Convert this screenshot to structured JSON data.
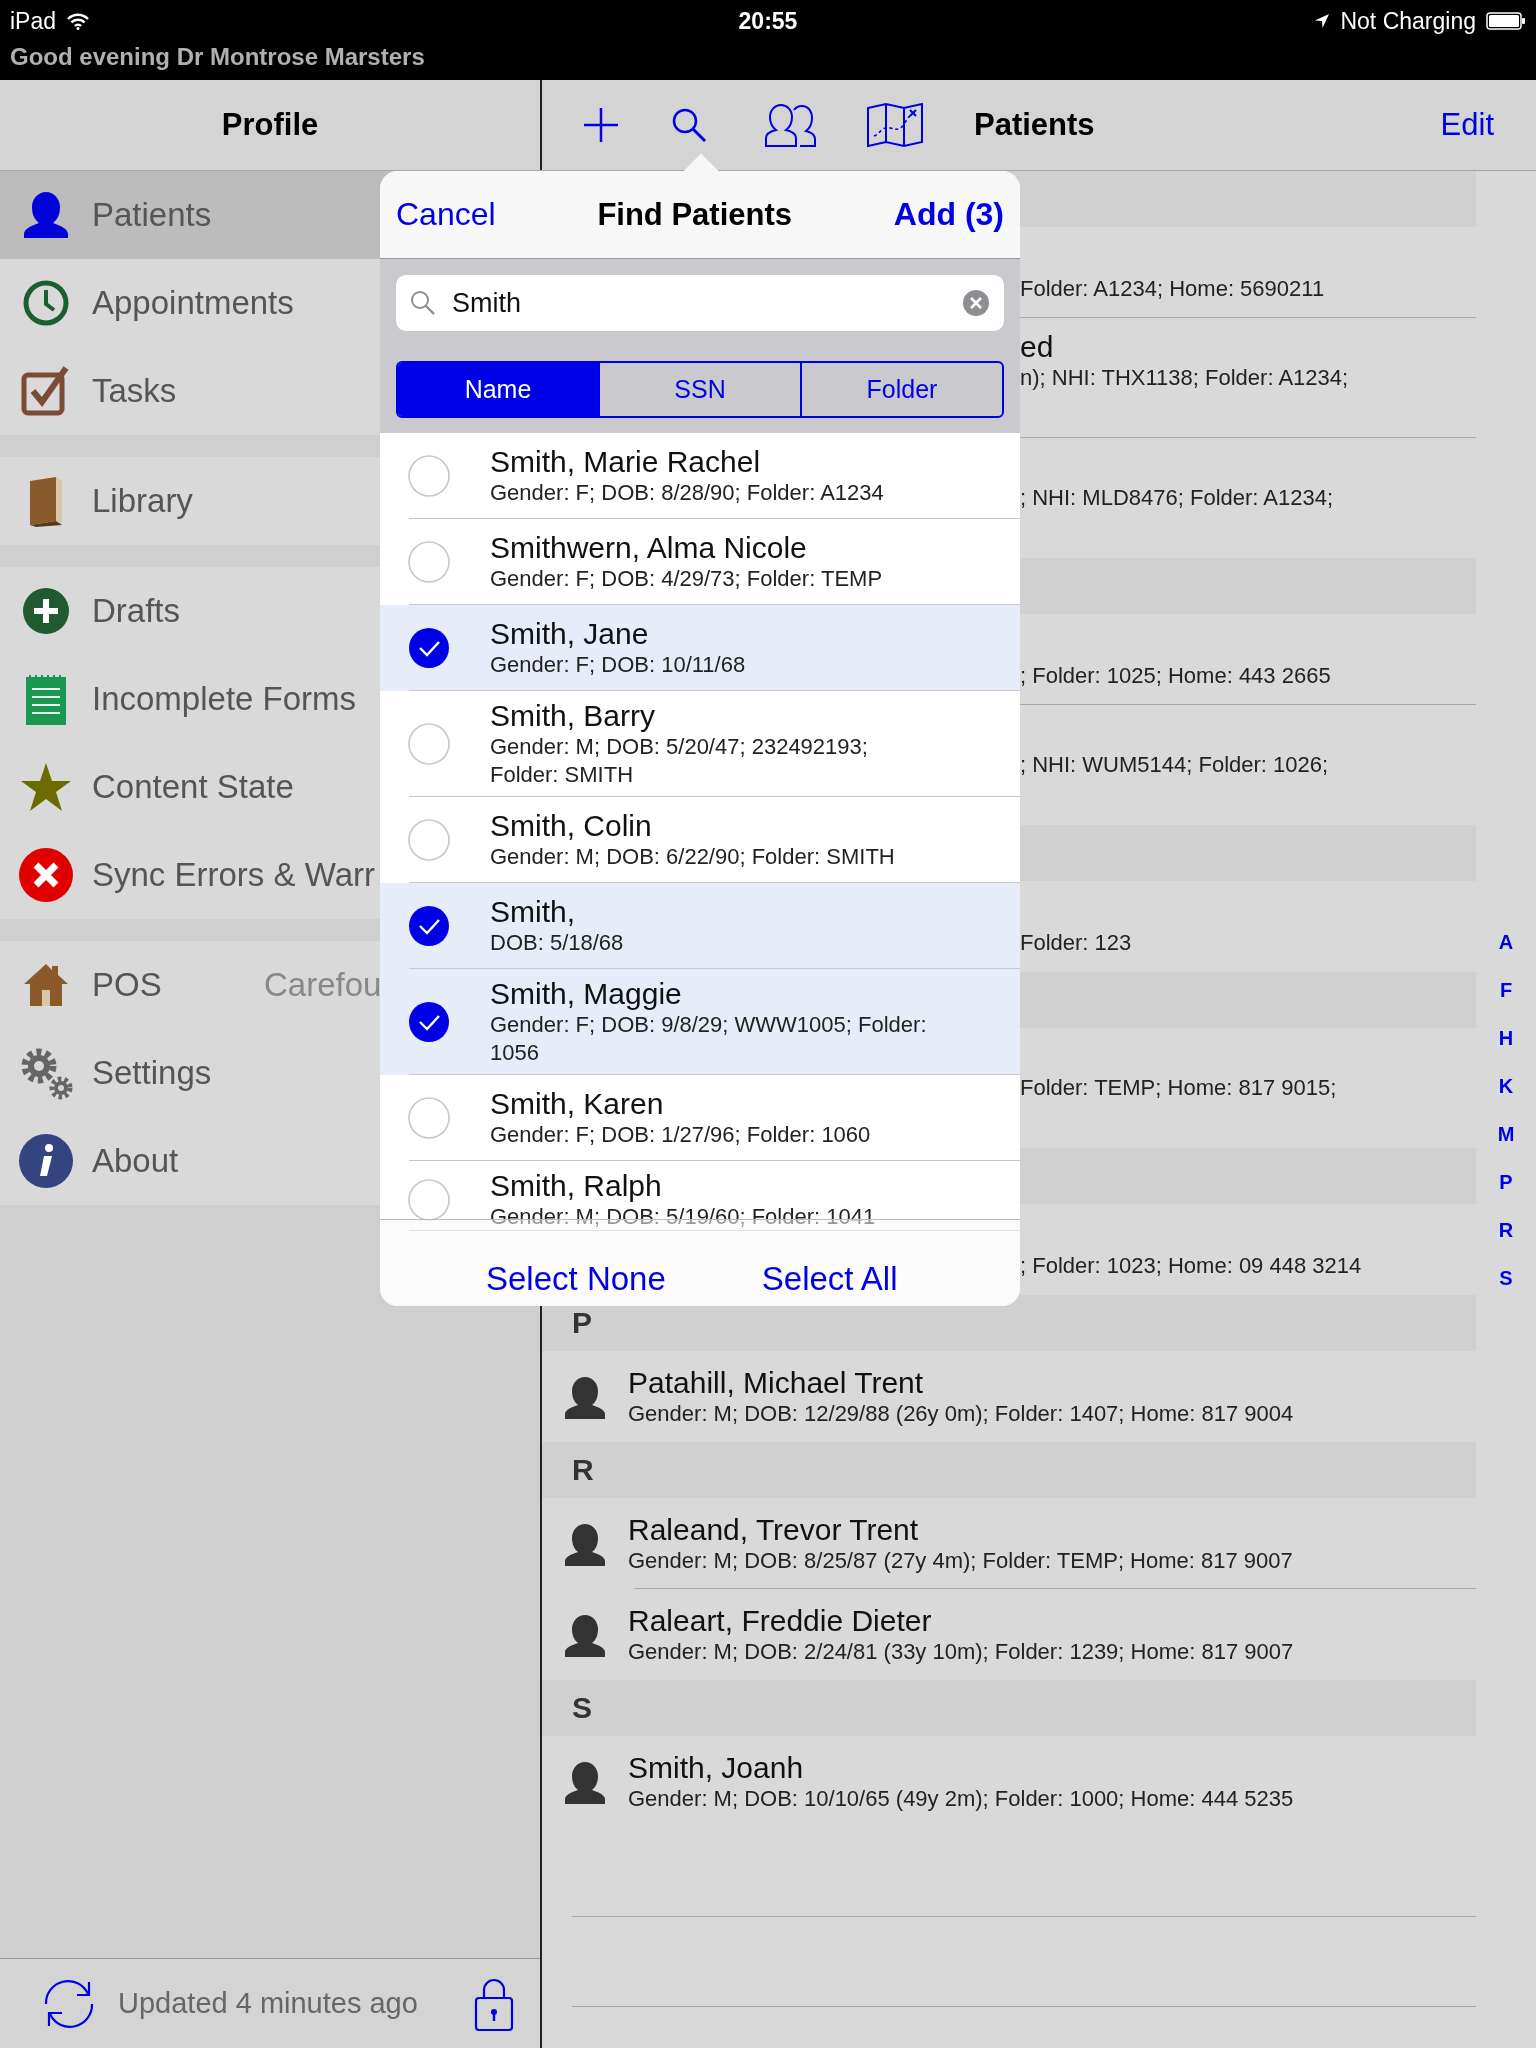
{
  "status_bar": {
    "device": "iPad",
    "time": "20:55",
    "battery_status": "Not Charging",
    "greeting": "Good evening Dr Montrose Marsters"
  },
  "sidebar": {
    "title": "Profile",
    "groups": [
      [
        {
          "label": "Patients",
          "selected": true
        },
        {
          "label": "Appointments",
          "selected": false
        },
        {
          "label": "Tasks",
          "selected": false
        }
      ],
      [
        {
          "label": "Library",
          "selected": false
        }
      ],
      [
        {
          "label": "Drafts",
          "selected": false
        },
        {
          "label": "Incomplete Forms",
          "selected": false
        },
        {
          "label": "Content State",
          "selected": false
        },
        {
          "label": "Sync Errors & Warr",
          "selected": false
        }
      ],
      [
        {
          "label": "POS",
          "detail": "Carefou",
          "selected": false
        },
        {
          "label": "Settings",
          "selected": false
        },
        {
          "label": "About",
          "selected": false
        }
      ]
    ],
    "footer": {
      "text": "Updated 4 minutes ago"
    }
  },
  "navbar": {
    "title": "Patients",
    "edit": "Edit"
  },
  "patients_list": {
    "sections": [
      {
        "rows": [
          {
            "kind": "partial",
            "details": "Folder: A1234; Home: 5690211",
            "wrapped": false
          },
          {
            "kind": "partial",
            "name": "ed",
            "details": "n); NHI: THX1138; Folder: A1234;",
            "wrapped": true
          },
          {
            "kind": "partial",
            "details": "; NHI: MLD8476; Folder: A1234;",
            "wrapped": true
          }
        ]
      },
      {
        "rows": [
          {
            "kind": "partial",
            "details": "; Folder: 1025; Home: 443 2665",
            "wrapped": false
          },
          {
            "kind": "partial",
            "details": "; NHI: WUM5144; Folder: 1026;",
            "wrapped": true
          }
        ]
      },
      {
        "rows": [
          {
            "kind": "partial",
            "details": "Folder: 123",
            "wrapped": false
          }
        ]
      },
      {
        "rows": [
          {
            "kind": "partial",
            "details": "Folder: TEMP; Home: 817 9015;",
            "wrapped": true
          }
        ]
      },
      {
        "rows": [
          {
            "kind": "partial",
            "details": "; Folder: 1023; Home: 09 448 3214",
            "wrapped": false
          }
        ]
      },
      {
        "letter": "P",
        "rows": [
          {
            "kind": "full",
            "name": "Patahill, Michael Trent",
            "details": "Gender: M; DOB: 12/29/88 (26y 0m); Folder: 1407; Home: 817 9004"
          }
        ]
      },
      {
        "letter": "R",
        "rows": [
          {
            "kind": "full",
            "name": "Raleand, Trevor Trent",
            "details": "Gender: M; DOB: 8/25/87 (27y 4m); Folder: TEMP; Home: 817 9007"
          },
          {
            "kind": "full",
            "name": "Raleart, Freddie Dieter",
            "details": "Gender: M; DOB: 2/24/81 (33y 10m); Folder: 1239; Home: 817 9007"
          }
        ]
      },
      {
        "letter": "S",
        "rows": [
          {
            "kind": "full",
            "name": "Smith, Joanh",
            "details": "Gender: M; DOB: 10/10/65 (49y 2m); Folder: 1000; Home: 444 5235"
          }
        ]
      }
    ],
    "index": [
      "A",
      "F",
      "H",
      "K",
      "M",
      "P",
      "R",
      "S"
    ]
  },
  "find_patients": {
    "cancel": "Cancel",
    "title": "Find Patients",
    "add": "Add (3)",
    "search": {
      "value": "Smith"
    },
    "segments": [
      {
        "label": "Name",
        "selected": true
      },
      {
        "label": "SSN",
        "selected": false
      },
      {
        "label": "Folder",
        "selected": false
      }
    ],
    "results": [
      {
        "name": "Smith, Marie Rachel",
        "details": "Gender: F; DOB: 8/28/90; Folder: A1234",
        "selected": false
      },
      {
        "name": "Smithwern, Alma Nicole",
        "details": "Gender: F; DOB: 4/29/73; Folder: TEMP",
        "selected": false
      },
      {
        "name": "Smith, Jane",
        "details": "Gender: F; DOB: 10/11/68",
        "selected": true
      },
      {
        "name": "Smith, Barry",
        "details": "Gender: M; DOB: 5/20/47; 232492193; Folder: SMITH",
        "selected": false
      },
      {
        "name": "Smith, Colin",
        "details": "Gender: M; DOB: 6/22/90; Folder: SMITH",
        "selected": false
      },
      {
        "name": "Smith,",
        "details": "DOB: 5/18/68",
        "selected": true
      },
      {
        "name": "Smith, Maggie",
        "details": "Gender: F; DOB: 9/8/29; WWW1005; Folder: 1056",
        "selected": true
      },
      {
        "name": "Smith, Karen",
        "details": "Gender: F; DOB: 1/27/96; Folder: 1060",
        "selected": false
      },
      {
        "name": "Smith, Ralph",
        "details": "Gender: M; DOB: 5/19/60; Folder: 1041",
        "selected": false
      }
    ],
    "footer": [
      "Select None",
      "Select All"
    ]
  }
}
